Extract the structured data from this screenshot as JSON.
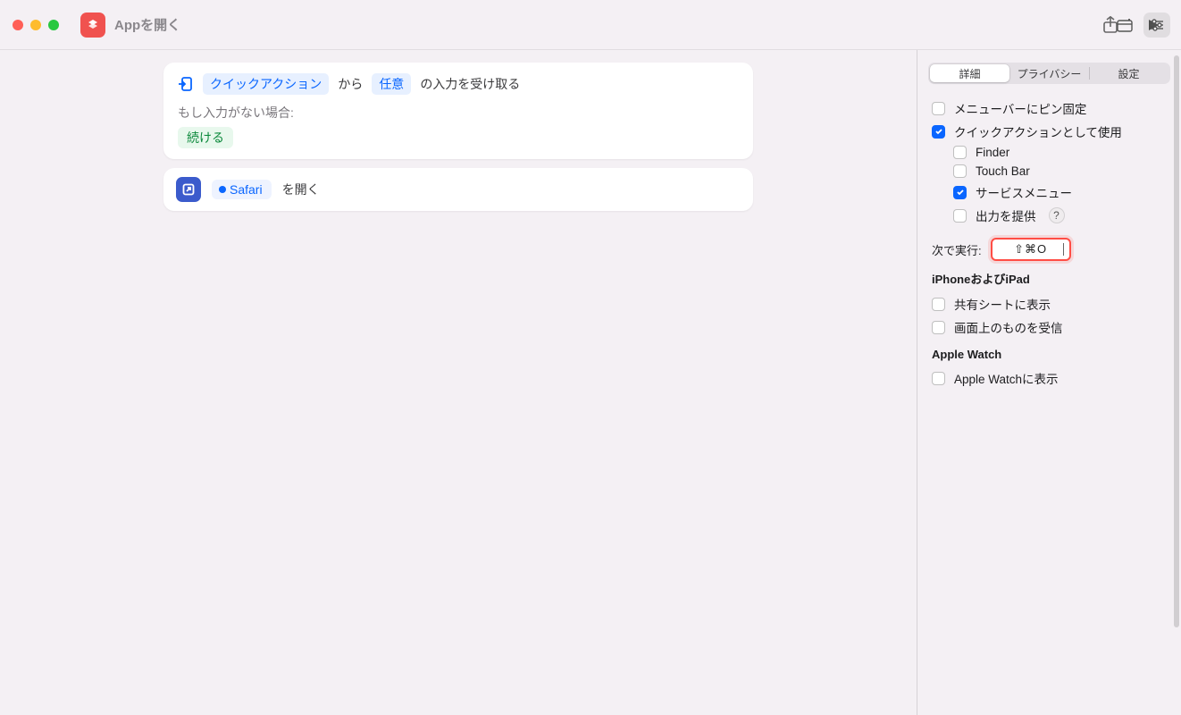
{
  "toolbar": {
    "app_title": "Appを開く"
  },
  "canvas": {
    "input_block": {
      "token_quickaction": "クイックアクション",
      "text_from": "から",
      "token_any": "任意",
      "text_receives": "の入力を受け取る",
      "no_input_label": "もし入力がない場合:",
      "continue_label": "続ける"
    },
    "open_app": {
      "app_name": "Safari",
      "open_label": "を開く"
    }
  },
  "panel": {
    "tabs": {
      "detail": "詳細",
      "privacy": "プライバシー",
      "settings": "設定"
    },
    "pin_menubar": "メニューバーにピン固定",
    "use_as_quickaction": "クイックアクションとして使用",
    "finder": "Finder",
    "touchbar": "Touch Bar",
    "services_menu": "サービスメニュー",
    "provide_output": "出力を提供",
    "run_with_label": "次で実行:",
    "shortcut_value": "⇧⌘O",
    "section_ios": "iPhoneおよびiPad",
    "share_sheet": "共有シートに表示",
    "receive_onscreen": "画面上のものを受信",
    "section_watch": "Apple Watch",
    "show_on_watch": "Apple Watchに表示"
  }
}
